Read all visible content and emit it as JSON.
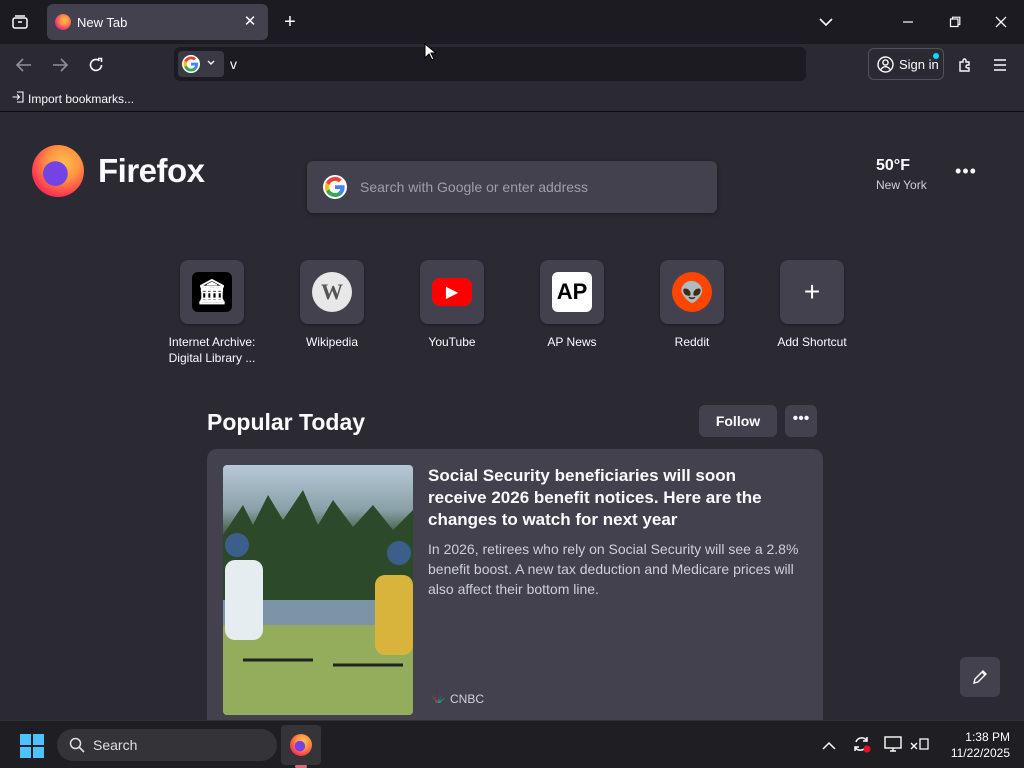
{
  "browser": {
    "tab": {
      "title": "New Tab"
    },
    "urlbar": {
      "value": "v"
    },
    "signin_label": "Sign in",
    "bookmarks": [
      {
        "label": "Import bookmarks..."
      }
    ]
  },
  "newtab": {
    "brand": "Firefox",
    "search_placeholder": "Search with Google or enter address",
    "weather": {
      "temp": "50°F",
      "city": "New York"
    },
    "shortcuts": [
      {
        "label": "Internet Archive: Digital Library ...",
        "icon": "internet-archive-icon",
        "bg": "#000000",
        "fg": "#ffffff",
        "glyph": "🏛"
      },
      {
        "label": "Wikipedia",
        "icon": "wikipedia-icon",
        "bg": "#ffffff",
        "fg": "#555555",
        "glyph": "W"
      },
      {
        "label": "YouTube",
        "icon": "youtube-icon",
        "bg": "#ff0000",
        "fg": "#ffffff",
        "glyph": "▶"
      },
      {
        "label": "AP News",
        "icon": "ap-news-icon",
        "bg": "#ffffff",
        "fg": "#000000",
        "glyph": "AP"
      },
      {
        "label": "Reddit",
        "icon": "reddit-icon",
        "bg": "#ff4500",
        "fg": "#ffffff",
        "glyph": "👽"
      },
      {
        "label": "Add Shortcut",
        "icon": "plus-icon",
        "bg": "#42414d",
        "fg": "#fbfbfe",
        "glyph": "+"
      }
    ],
    "popular": {
      "title": "Popular Today",
      "follow_label": "Follow",
      "card": {
        "headline": "Social Security beneficiaries will soon receive 2026 benefit notices. Here are the changes to watch for next year",
        "description": "In 2026, retirees who rely on Social Security will see a 2.8% benefit boost. A new tax deduction and Medicare prices will also affect their bottom line.",
        "source": "CNBC"
      }
    }
  },
  "taskbar": {
    "search_label": "Search",
    "time": "1:38 PM",
    "date": "11/22/2025"
  },
  "colors": {
    "accent": "#00ddff",
    "firefox_orange": "#ff9640",
    "page_bg": "#2b2a33"
  }
}
